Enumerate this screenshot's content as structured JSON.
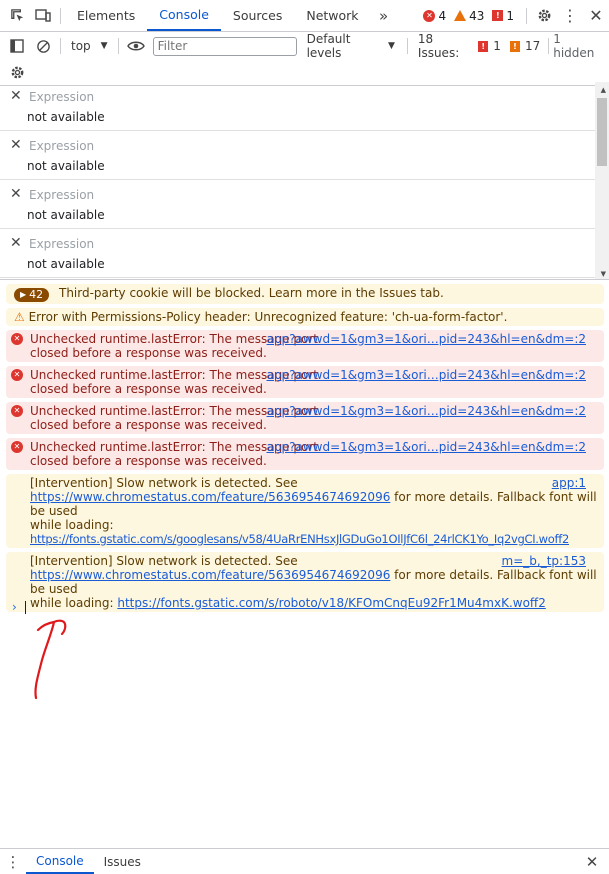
{
  "tabs": [
    "Elements",
    "Console",
    "Sources",
    "Network"
  ],
  "badges": {
    "errors": "4",
    "warnings": "43",
    "issues": "1"
  },
  "toolbar": {
    "context": "top",
    "filter_placeholder": "Filter",
    "levels": "Default levels",
    "issues_label": "18 Issues:",
    "issue_errors": "1",
    "issue_warnings": "17",
    "hidden": "1 hidden"
  },
  "watch": [
    {
      "name": "Expression",
      "value": "not available"
    },
    {
      "name": "Expression",
      "value": "not available"
    },
    {
      "name": "Expression",
      "value": "not available"
    },
    {
      "name": "Expression",
      "value": "not available"
    }
  ],
  "messages": {
    "m0_count": "42",
    "m0_text": "Third-party cookie will be blocked. Learn more in the Issues tab.",
    "m1_text": "Error with Permissions-Policy header: Unrecognized feature: 'ch-ua-form-factor'.",
    "err_line1": "Unchecked runtime.lastError: The message port",
    "err_line2": "closed before a response was received.",
    "err_src": "app?awwd=1&gm3=1&ori…pid=243&hl=en&dm=:2",
    "w1_line1": "[Intervention] Slow network is detected. See",
    "w1_src": "app:1",
    "w1_link1": "https://www.chromestatus.com/feature/5636954674692096",
    "w1_rest": " for more details. Fallback font will be used",
    "w1_line3": "while loading:",
    "w1_link2": "https://fonts.gstatic.com/s/googlesans/v58/4UaRrENHsxJlGDuGo1OIlJfC6l_24rlCK1Yo_Iq2vgCI.woff2",
    "w2_line1": "[Intervention] Slow network is detected. See",
    "w2_src": "m=_b,_tp:153",
    "w2_link1": "https://www.chromestatus.com/feature/5636954674692096",
    "w2_rest": " for more details. Fallback font will be used",
    "w2_line3": "while loading: ",
    "w2_link2": "https://fonts.gstatic.com/s/roboto/v18/KFOmCnqEu92Fr1Mu4mxK.woff2"
  },
  "drawer": {
    "console": "Console",
    "issues": "Issues"
  },
  "colors": {
    "accent": "#0b57d0",
    "error": "#dc362e",
    "warning": "#e8710a"
  }
}
